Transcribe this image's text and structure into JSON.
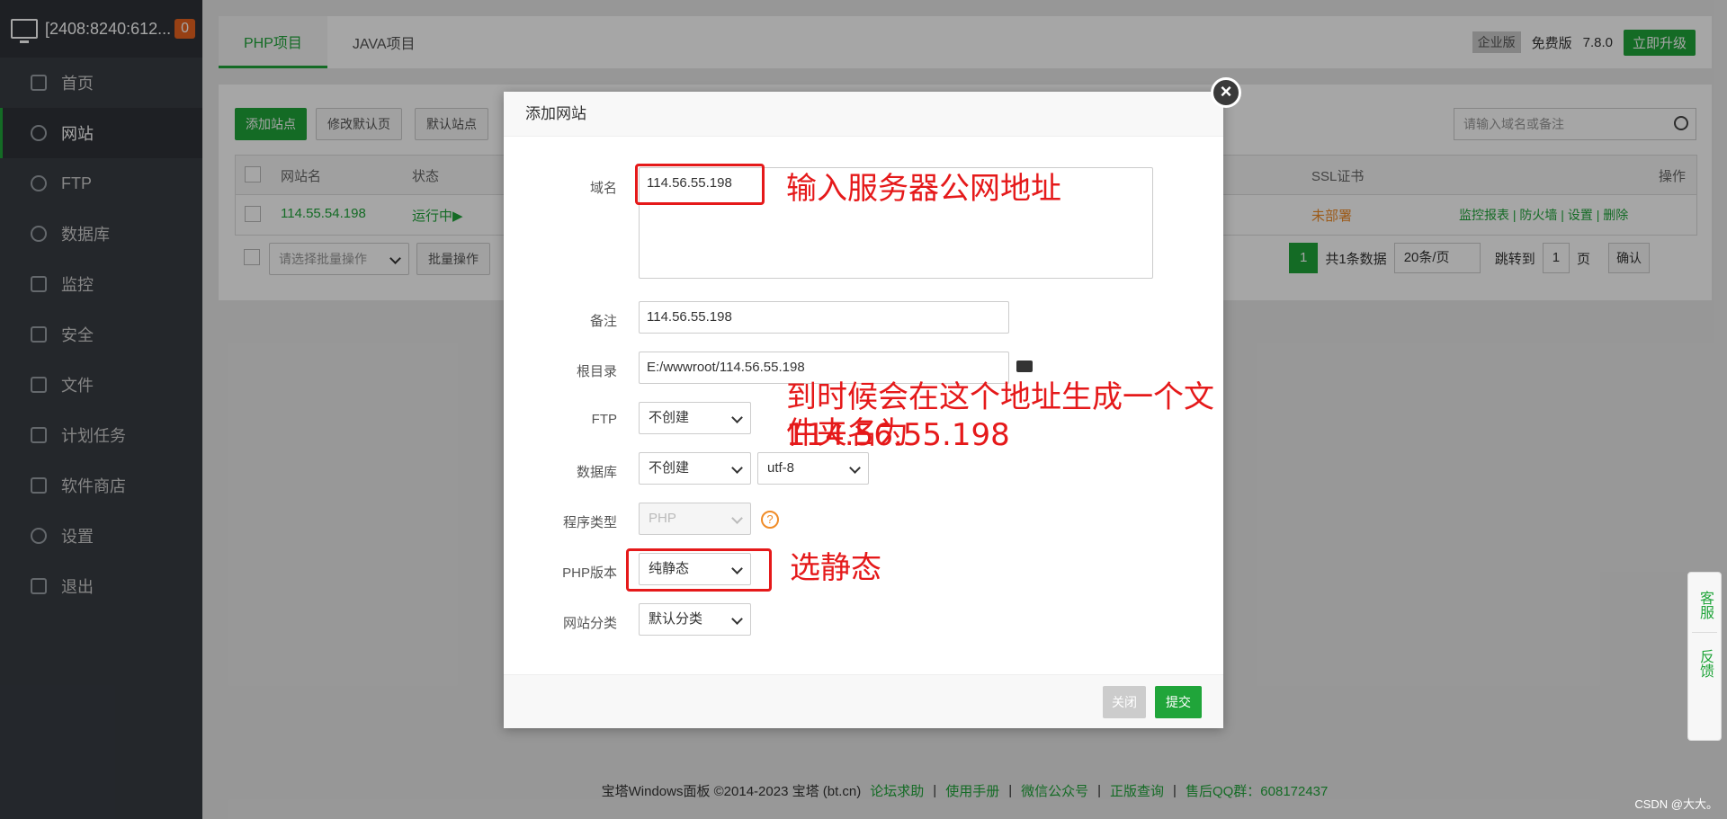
{
  "sidebar": {
    "server": "[2408:8240:612...",
    "badge": "0",
    "items": [
      {
        "label": "首页",
        "icon": "home-icon"
      },
      {
        "label": "网站",
        "icon": "globe-icon"
      },
      {
        "label": "FTP",
        "icon": "ftp-icon"
      },
      {
        "label": "数据库",
        "icon": "database-icon"
      },
      {
        "label": "监控",
        "icon": "monitor-icon"
      },
      {
        "label": "安全",
        "icon": "shield-icon"
      },
      {
        "label": "文件",
        "icon": "folder-icon"
      },
      {
        "label": "计划任务",
        "icon": "calendar-icon"
      },
      {
        "label": "软件商店",
        "icon": "grid-icon"
      },
      {
        "label": "设置",
        "icon": "gear-icon"
      },
      {
        "label": "退出",
        "icon": "logout-icon"
      }
    ]
  },
  "topbar": {
    "tabs": [
      "PHP项目",
      "JAVA项目"
    ],
    "enterprise": "企业版",
    "free": "免费版",
    "version": "7.8.0",
    "upgrade": "立即升级"
  },
  "toolbar": {
    "add_site": "添加站点",
    "modify_default": "修改默认页",
    "default_site": "默认站点",
    "search_placeholder": "请输入域名或备注"
  },
  "table": {
    "headers": {
      "name": "网站名",
      "status": "状态",
      "ssl": "SSL证书",
      "ops": "操作"
    },
    "row": {
      "name": "114.55.54.198",
      "status": "运行中▶",
      "ssl": "未部署",
      "ops": [
        "监控报表",
        "防火墙",
        "设置",
        "删除"
      ]
    },
    "batch_placeholder": "请选择批量操作",
    "batch_btn": "批量操作",
    "pager": {
      "page": "1",
      "total": "共1条数据",
      "per_page": "20条/页",
      "jump": "跳转到",
      "jump_val": "1",
      "unit": "页",
      "confirm": "确认"
    }
  },
  "dialog": {
    "title": "添加网站",
    "fields": {
      "domain_label": "域名",
      "domain_value": "114.56.55.198",
      "remark_label": "备注",
      "remark_value": "114.56.55.198",
      "root_label": "根目录",
      "root_value": "E:/wwwroot/114.56.55.198",
      "ftp_label": "FTP",
      "ftp_value": "不创建",
      "db_label": "数据库",
      "db_value": "不创建",
      "charset_value": "utf-8",
      "prog_label": "程序类型",
      "prog_value": "PHP",
      "php_label": "PHP版本",
      "php_value": "纯静态",
      "cat_label": "网站分类",
      "cat_value": "默认分类"
    },
    "close_btn": "关闭",
    "submit_btn": "提交"
  },
  "annotations": {
    "a1": "输入服务器公网地址",
    "a2_line1": "到时候会在这个地址生成一个文件夹名为",
    "a2_line2": "114.56.55.198",
    "a3": "选静态"
  },
  "footer": {
    "copyright": "宝塔Windows面板 ©2014-2023 宝塔 (bt.cn)",
    "links": [
      "论坛求助",
      "使用手册",
      "微信公众号",
      "正版查询",
      "售后QQ群：608172437"
    ]
  },
  "float": {
    "service": "客服",
    "feedback": "反馈"
  },
  "watermark": "CSDN @大大。"
}
